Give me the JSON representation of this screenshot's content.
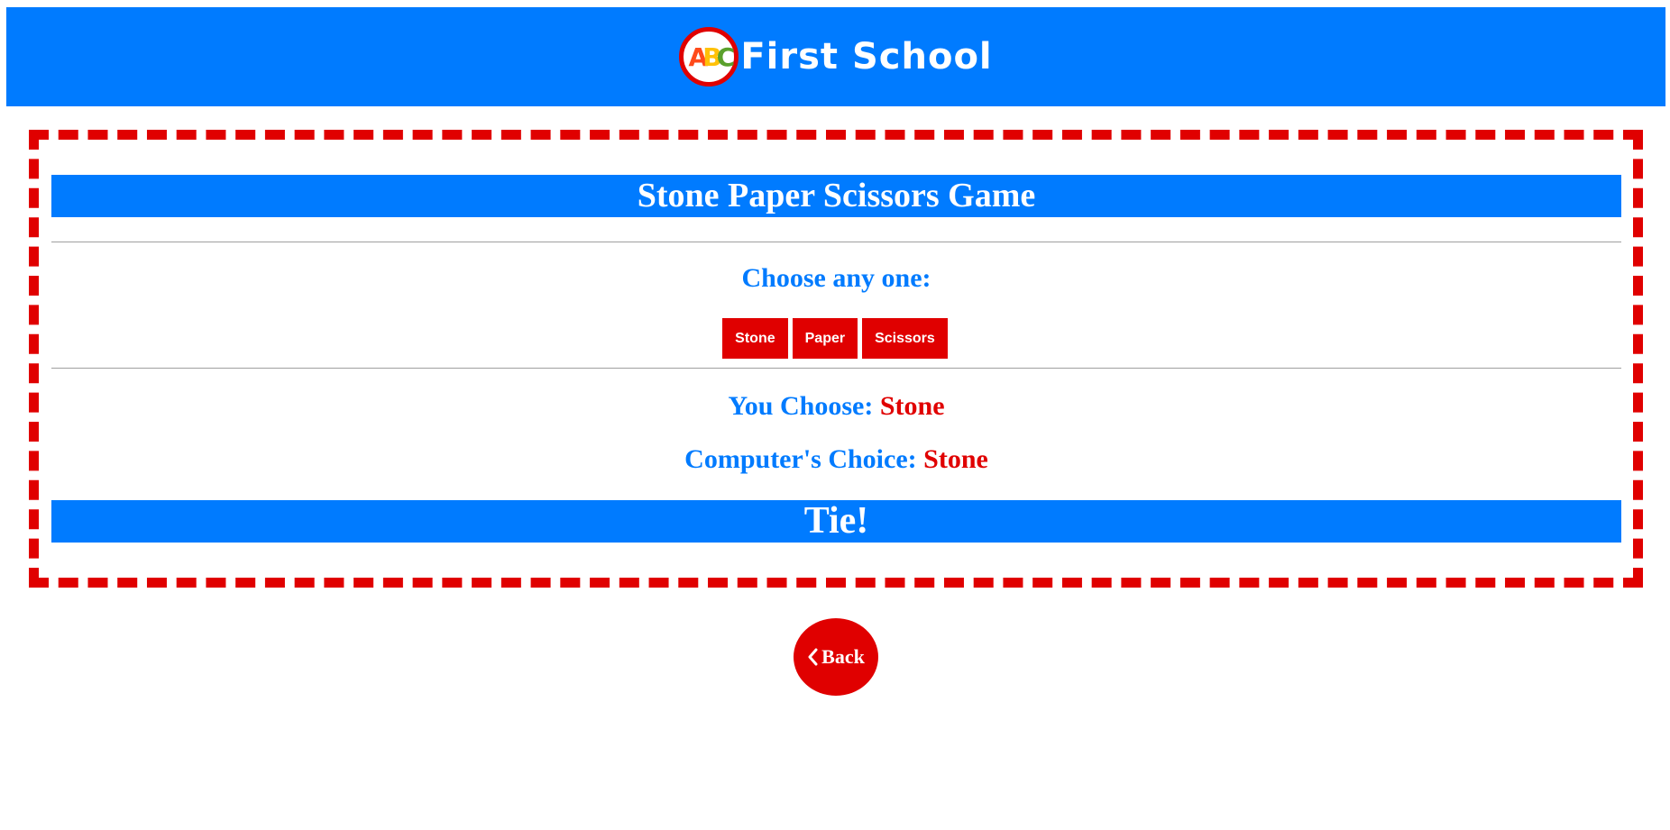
{
  "header": {
    "logo": {
      "icon": "abc-logo-icon",
      "letters": [
        "A",
        "B",
        "C"
      ],
      "colors": [
        "#ff4a1a",
        "#ffc107",
        "#5aa02c"
      ]
    },
    "brand_name": "First School",
    "background": "#007bff"
  },
  "game": {
    "title": "Stone Paper Scissors Game",
    "prompt": "Choose any one:",
    "choices": [
      "Stone",
      "Paper",
      "Scissors"
    ],
    "you_label": "You Choose:",
    "you_value": "Stone",
    "computer_label": "Computer's Choice:",
    "computer_value": "Stone",
    "result": "Tie!"
  },
  "nav": {
    "back_label": "Back",
    "back_icon": "chevron-left-icon"
  },
  "colors": {
    "primary_blue": "#007bff",
    "accent_red": "#e00000"
  }
}
